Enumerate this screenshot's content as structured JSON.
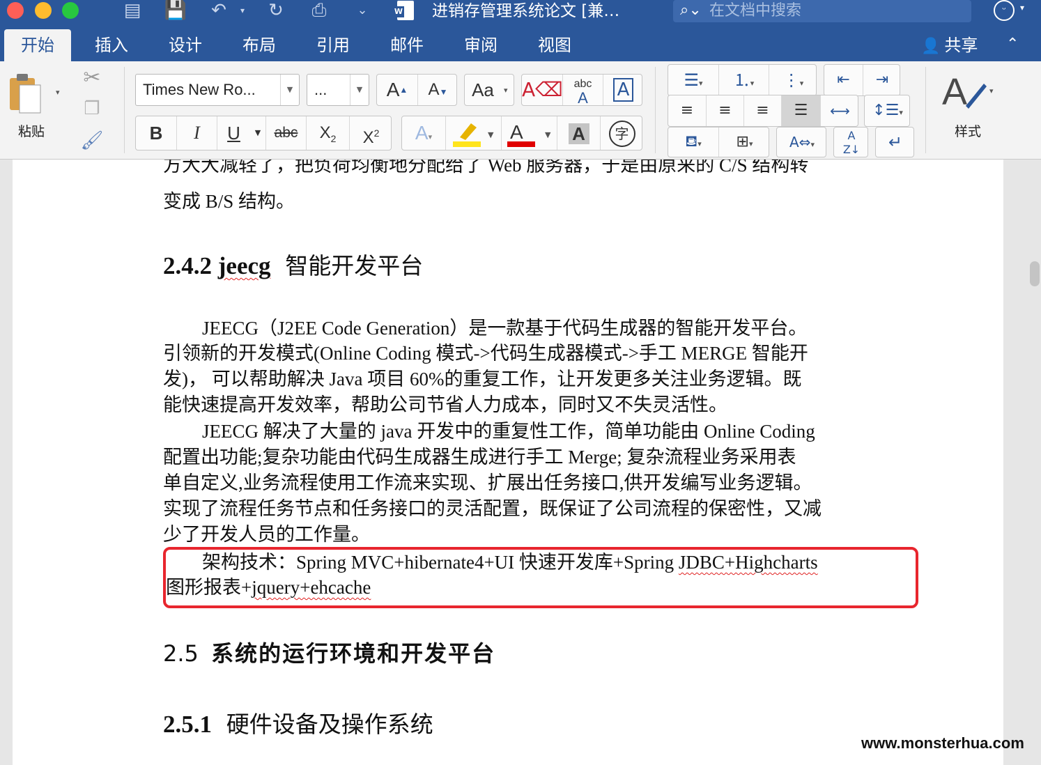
{
  "window": {
    "title": "进销存管理系统论文 [兼…",
    "search_placeholder": "在文档中搜索"
  },
  "ribbon_tabs": [
    "开始",
    "插入",
    "设计",
    "布局",
    "引用",
    "邮件",
    "审阅",
    "视图"
  ],
  "share_label": "共享",
  "clipboard": {
    "paste_label": "粘贴"
  },
  "font": {
    "family": "Times New Ro...",
    "size": "...",
    "grow_label": "A",
    "shrink_label": "A",
    "bold": "B",
    "italic": "I",
    "underline": "U",
    "strike": "abc",
    "subscript": "X",
    "superscript": "X",
    "highlight_color": "#ffe41c",
    "font_color": "#e00000"
  },
  "styles_label": "样式",
  "document": {
    "line_cut": "方大大减轻了，把负荷均衡地分配给了 Web 服务器，于是由原来的 C/S 结构转",
    "line_top": "变成 B/S 结构。",
    "heading_242": {
      "number": "2.4.2",
      "word": "jeecg",
      "rest": "智能开发平台"
    },
    "para1": [
      "JEECG（J2EE  Code  Generation）是一款基于代码生成器的智能开发平台。",
      "引领新的开发模式(Online  Coding 模式->代码生成器模式->手工 MERGE 智能开",
      "发)，  可以帮助解决 Java 项目 60%的重复工作，让开发更多关注业务逻辑。既",
      "能快速提高开发效率，帮助公司节省人力成本，同时又不失灵活性。"
    ],
    "para2": [
      "JEECG 解决了大量的 java 开发中的重复性工作，简单功能由 Online Coding",
      "配置出功能;复杂功能由代码生成器生成进行手工  Merge;  复杂流程业务采用表",
      "单自定义,业务流程使用工作流来实现、扩展出任务接口,供开发编写业务逻辑。",
      "实现了流程任务节点和任务接口的灵活配置，既保证了公司流程的保密性，又减",
      "少了开发人员的工作量。"
    ],
    "para3": {
      "line1_pre": "架构技术：Spring MVC+hibernate4+UI 快速开发库+Spring ",
      "line1_squig": "JDBC+Highcharts",
      "line2_pre": "图形报表+",
      "line2_squig": "jquery+ehcache"
    },
    "heading_25": {
      "number": "2.5",
      "text": "系统的运行环境和开发平台"
    },
    "heading_251": {
      "number": "2.5.1",
      "text": "硬件设备及操作系统"
    }
  },
  "watermark": "www.monsterhua.com",
  "colors": {
    "title_bar": "#2b579a",
    "highlight_box": "#e8262e",
    "spell_squiggle": "#e02020"
  }
}
